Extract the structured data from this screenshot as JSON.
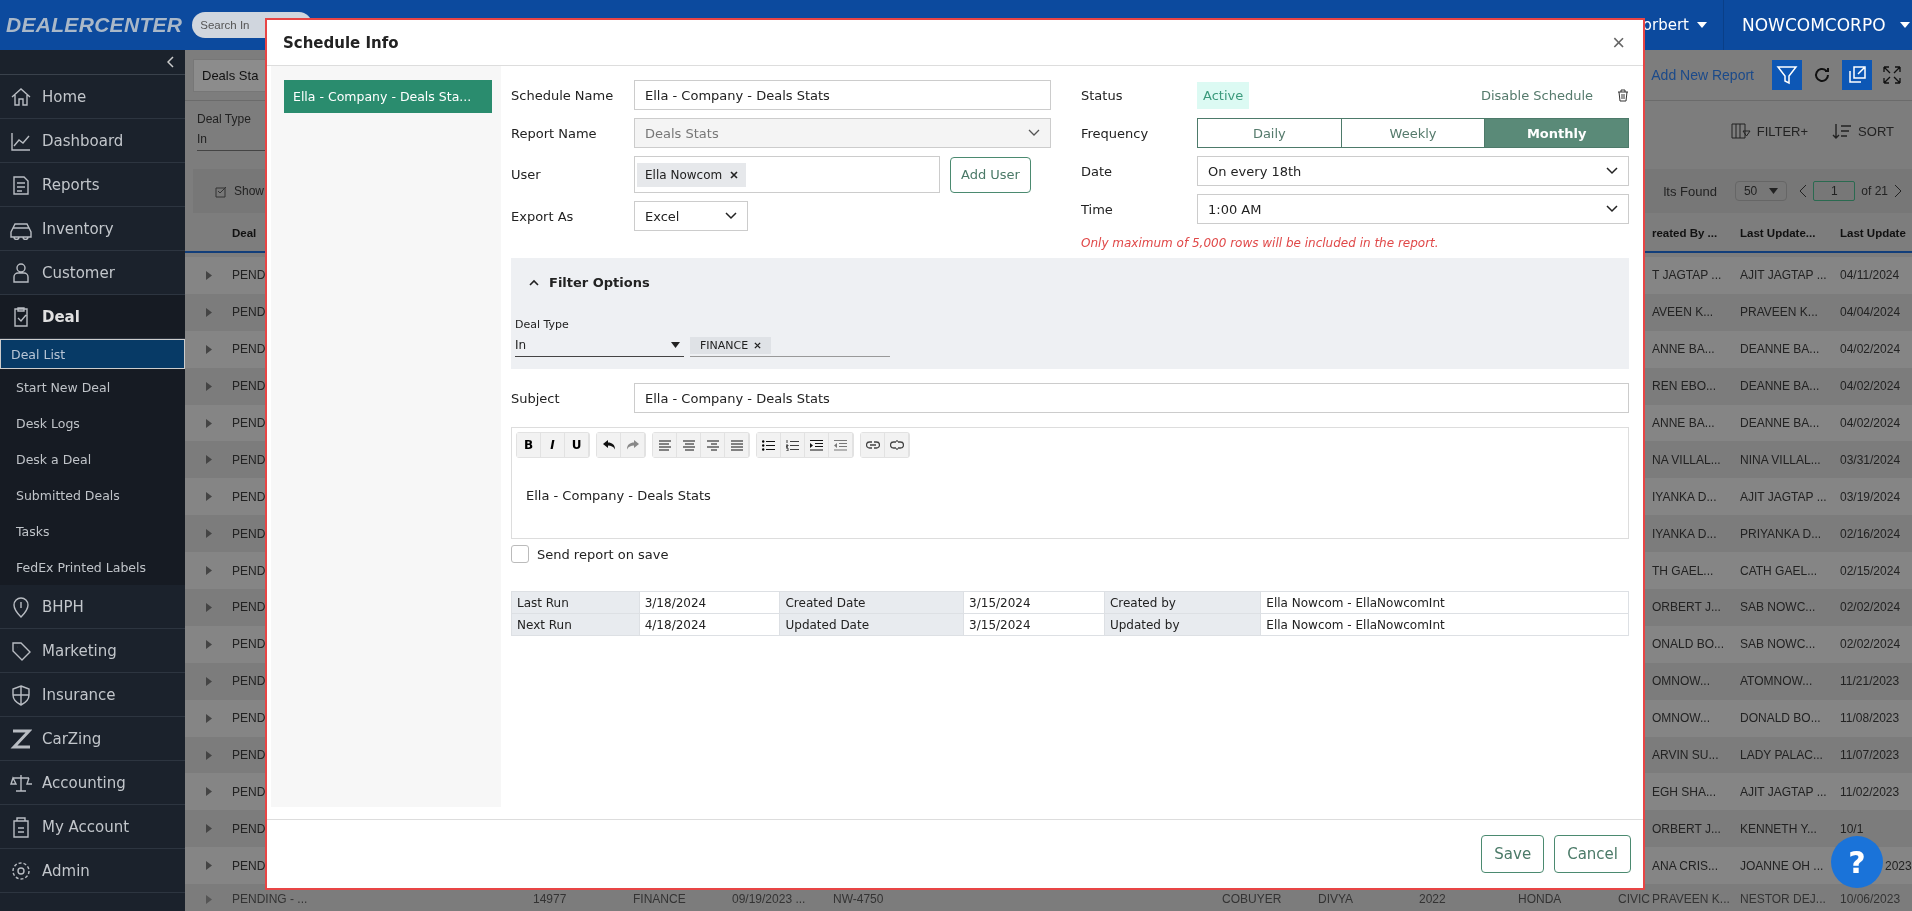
{
  "top_bar": {
    "logo": "DEALERCENTER",
    "search_placeholder": "Search In",
    "user": "orbert",
    "company": "NOWCOMCORPO"
  },
  "sidebar": {
    "items": [
      {
        "label": "Home",
        "expanded": false
      },
      {
        "label": "Dashboard",
        "expanded": false
      },
      {
        "label": "Reports",
        "expanded": false
      },
      {
        "label": "Inventory",
        "expanded": false
      },
      {
        "label": "Customer",
        "expanded": false
      },
      {
        "label": "Deal",
        "expanded": true,
        "children": [
          {
            "label": "Deal List",
            "selected": true
          },
          {
            "label": "Start New Deal",
            "selected": false
          },
          {
            "label": "Desk Logs",
            "selected": false
          },
          {
            "label": "Desk a Deal",
            "selected": false
          },
          {
            "label": "Submitted Deals",
            "selected": false
          },
          {
            "label": "Tasks",
            "selected": false
          },
          {
            "label": "FedEx Printed Labels",
            "selected": false
          }
        ]
      },
      {
        "label": "BHPH",
        "expanded": false
      },
      {
        "label": "Marketing",
        "expanded": false
      },
      {
        "label": "Insurance",
        "expanded": false
      },
      {
        "label": "CarZing",
        "expanded": false
      },
      {
        "label": "Accounting",
        "expanded": false
      },
      {
        "label": "My Account",
        "expanded": false
      },
      {
        "label": "Admin",
        "expanded": false
      }
    ]
  },
  "page": {
    "tab": "Deals Sta",
    "filter": {
      "label": "Deal Type",
      "value": "In"
    },
    "show_label": "Show",
    "add_new_report": "Add New Report",
    "filter_plus": "FILTER+",
    "sort": "SORT",
    "results": {
      "found": "lts Found",
      "page_size": "50",
      "page": "1",
      "of": "of 21"
    },
    "columns": [
      "Deal",
      "reated By ...",
      "Last Update...",
      "Last Update"
    ],
    "rows": [
      {
        "status": "PEND",
        "created_by": "T JAGTAP ...",
        "last_updated_by": "AJIT JAGTAP ...",
        "last_update": "04/11/2024"
      },
      {
        "status": "PEND",
        "created_by": "AVEEN K...",
        "last_updated_by": "PRAVEEN K...",
        "last_update": "04/04/2024"
      },
      {
        "status": "PEND",
        "created_by": "ANNE BA...",
        "last_updated_by": "DEANNE BA...",
        "last_update": "04/02/2024"
      },
      {
        "status": "PEND",
        "created_by": "REN EBO...",
        "last_updated_by": "DEANNE BA...",
        "last_update": "04/02/2024"
      },
      {
        "status": "PEND",
        "created_by": "ANNE BA...",
        "last_updated_by": "DEANNE BA...",
        "last_update": "04/02/2024"
      },
      {
        "status": "PEND",
        "created_by": "NA VILLAL...",
        "last_updated_by": "NINA VILLAL...",
        "last_update": "03/31/2024"
      },
      {
        "status": "PEND",
        "created_by": "IYANKA D...",
        "last_updated_by": "AJIT JAGTAP ...",
        "last_update": "03/19/2024"
      },
      {
        "status": "PEND",
        "created_by": "IYANKA D...",
        "last_updated_by": "PRIYANKA D...",
        "last_update": "02/16/2024"
      },
      {
        "status": "PEND",
        "created_by": "TH GAEL...",
        "last_updated_by": "CATH GAEL...",
        "last_update": "02/15/2024"
      },
      {
        "status": "PEND",
        "created_by": "ORBERT J...",
        "last_updated_by": "SAB NOWC...",
        "last_update": "02/02/2024"
      },
      {
        "status": "PEND",
        "created_by": "ONALD BO...",
        "last_updated_by": "SAB NOWC...",
        "last_update": "02/02/2024"
      },
      {
        "status": "PEND",
        "created_by": "OMNOW...",
        "last_updated_by": "ATOMNOW...",
        "last_update": "11/21/2023"
      },
      {
        "status": "PEND",
        "created_by": "OMNOW...",
        "last_updated_by": "DONALD BO...",
        "last_update": "11/08/2023"
      },
      {
        "status": "PEND",
        "created_by": "ARVIN SU...",
        "last_updated_by": "LADY PALAC...",
        "last_update": "11/07/2023"
      },
      {
        "status": "PEND",
        "created_by": "EGH SHA...",
        "last_updated_by": "AJIT JAGTAP ...",
        "last_update": "11/02/2023"
      },
      {
        "status": "PEND",
        "created_by": "ORBERT J...",
        "last_updated_by": "KENNETH Y...",
        "last_update": "10/1"
      },
      {
        "status": "PEND",
        "created_by": "ANA CRIS...",
        "last_updated_by": "JOANNE OH ...",
        "last_update": "2023"
      }
    ],
    "bottom_row": [
      "PENDING - ...",
      "14977",
      "FINANCE",
      "09/19/2023 ...",
      "NW-4750",
      "COBUYER",
      "DIVYA",
      "2022",
      "HONDA",
      "CIVIC",
      "PRAVEEN K...",
      "NESTOR DEJ...",
      "10/06/2023"
    ],
    "help": "?"
  },
  "dialog": {
    "title": "Schedule Info",
    "close": "×",
    "schedules": [
      {
        "label": "Ella - Company - Deals Sta...",
        "selected": true
      }
    ],
    "schedule_name": {
      "label": "Schedule Name",
      "value": "Ella - Company - Deals Stats"
    },
    "report_name": {
      "label": "Report Name",
      "value": "Deals Stats",
      "disabled": true
    },
    "user": {
      "label": "User",
      "chips": [
        "Ella Nowcom"
      ],
      "add_button": "Add User"
    },
    "export_as": {
      "label": "Export As",
      "value": "Excel"
    },
    "status": {
      "label": "Status",
      "value": "Active",
      "action": "Disable Schedule"
    },
    "frequency": {
      "label": "Frequency",
      "options": [
        {
          "label": "Daily",
          "selected": false
        },
        {
          "label": "Weekly",
          "selected": false
        },
        {
          "label": "Monthly",
          "selected": true
        }
      ]
    },
    "date": {
      "label": "Date",
      "value": "On every 18th"
    },
    "time": {
      "label": "Time",
      "value": "1:00 AM"
    },
    "warning": "Only maximum of 5,000 rows will be included in the report.",
    "filter_options": {
      "title": "Filter Options",
      "expanded": true,
      "filters": [
        {
          "label": "Deal Type",
          "operator": "In",
          "values": [
            "FINANCE"
          ]
        }
      ]
    },
    "subject": {
      "label": "Subject",
      "value": "Ella - Company - Deals Stats"
    },
    "format_buttons": [
      "B",
      "I",
      "U"
    ],
    "body": "Ella - Company - Deals Stats",
    "send_on_save": {
      "label": "Send report on save",
      "checked": false
    },
    "info": [
      [
        "Last Run",
        "3/18/2024",
        "Created Date",
        "3/15/2024",
        "Created by",
        "Ella Nowcom - EllaNowcomInt"
      ],
      [
        "Next Run",
        "4/18/2024",
        "Updated Date",
        "3/15/2024",
        "Updated by",
        "Ella Nowcom - EllaNowcomInt"
      ]
    ],
    "buttons": [
      "Save",
      "Cancel"
    ]
  }
}
